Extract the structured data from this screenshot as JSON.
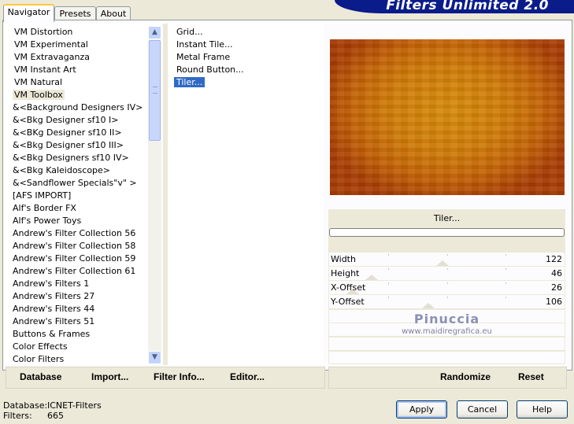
{
  "app": {
    "title": "Filters Unlimited 2.0",
    "tabs": [
      {
        "label": "Navigator",
        "active": true
      },
      {
        "label": "Presets",
        "active": false
      },
      {
        "label": "About",
        "active": false
      }
    ]
  },
  "filter_list": {
    "items": [
      "VM Distortion",
      "VM Experimental",
      "VM Extravaganza",
      "VM Instant Art",
      "VM Natural",
      "VM Toolbox",
      "&<Background Designers IV>",
      "&<Bkg Designer sf10 I>",
      "&<BKg Designer sf10 II>",
      "&<Bkg Designer sf10 III>",
      "&<Bkg Designers sf10 IV>",
      "&<Bkg Kaleidoscope>",
      "&<Sandflower Specials\"v\" >",
      "[AFS IMPORT]",
      "Alf's Border FX",
      "Alf's Power Toys",
      "Andrew's Filter Collection 56",
      "Andrew's Filter Collection 58",
      "Andrew's Filter Collection 59",
      "Andrew's Filter Collection 61",
      "Andrew's Filters 1",
      "Andrew's Filters 27",
      "Andrew's Filters 44",
      "Andrew's Filters 51",
      "Buttons & Frames",
      "Color Effects",
      "Color Filters"
    ],
    "selected_index": 5
  },
  "sub_list": {
    "items": [
      "Grid...",
      "Instant Tile...",
      "Metal Frame",
      "Round Button...",
      "Tiler..."
    ],
    "selected_index": 4
  },
  "filter_panel": {
    "name": "Tiler...",
    "params": [
      {
        "label": "Width",
        "value": "122",
        "level": 0.48
      },
      {
        "label": "Height",
        "value": "46",
        "level": 0.18
      },
      {
        "label": "X-Offset",
        "value": "26",
        "level": 0.1
      },
      {
        "label": "Y-Offset",
        "value": "106",
        "level": 0.42
      }
    ],
    "watermark_name": "Pinuccia",
    "watermark_url": "www.maidiregrafica.eu",
    "preview_colors": [
      "#d68a08",
      "#c26004",
      "#a83c02"
    ]
  },
  "toolbar": {
    "database_label": "Database",
    "import_label": "Import...",
    "filter_info_label": "Filter Info...",
    "editor_label": "Editor...",
    "randomize_label": "Randomize",
    "reset_label": "Reset"
  },
  "status": {
    "database_label": "Database:",
    "database_value": "ICNET-Filters",
    "filters_label": "Filters:",
    "filters_value": "665"
  },
  "dialog": {
    "apply_label": "Apply",
    "cancel_label": "Cancel",
    "help_label": "Help"
  },
  "icons": {
    "scroll_up": "triangle-up-icon",
    "scroll_down": "triangle-down-icon"
  }
}
